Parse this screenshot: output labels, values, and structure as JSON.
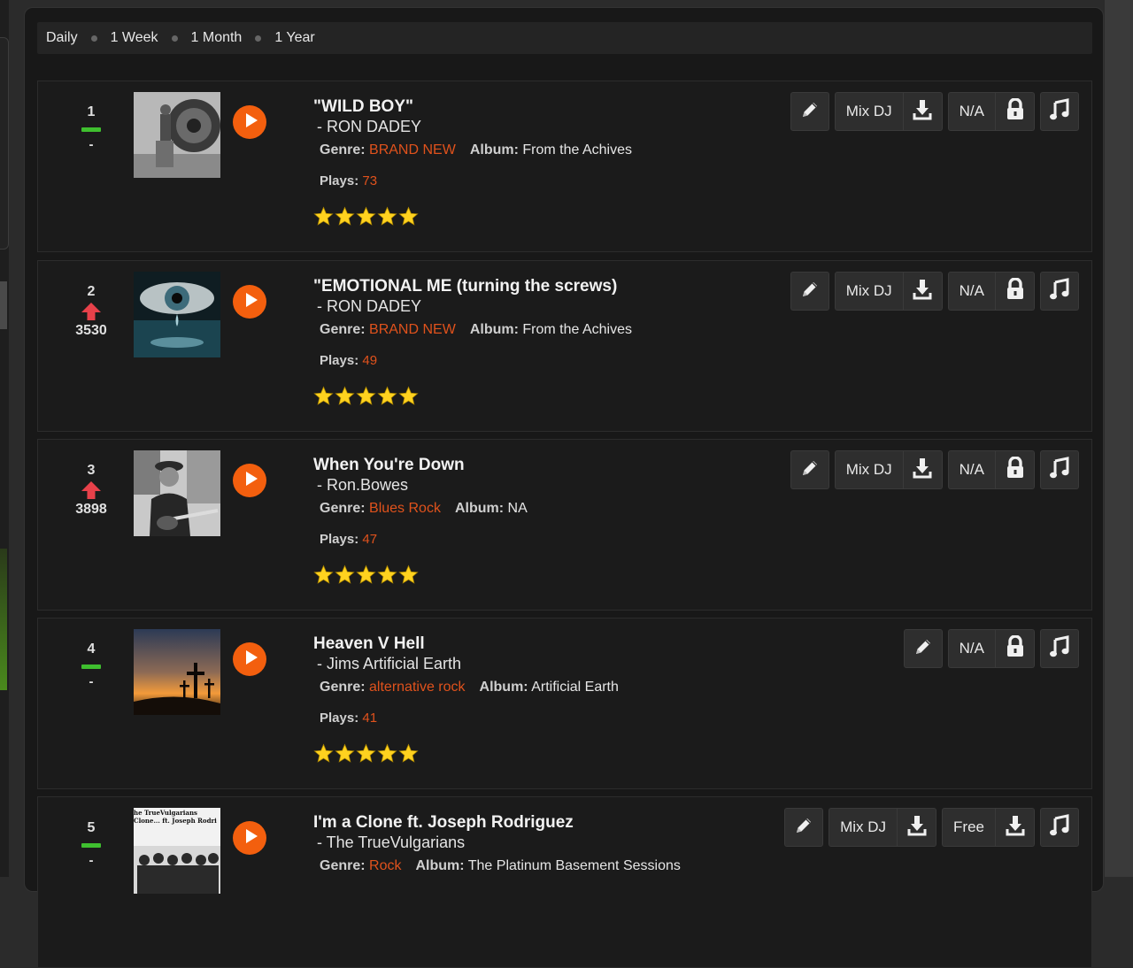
{
  "filters": [
    "Daily",
    "1 Week",
    "1 Month",
    "1 Year"
  ],
  "colors": {
    "accent": "#f35f0e",
    "genre": "#e0521c",
    "rank_up": "#e8414a",
    "rank_same": "#3fbf2f"
  },
  "labels": {
    "genre": "Genre:",
    "album": "Album:",
    "plays": "Plays:"
  },
  "tracks": [
    {
      "rank": "1",
      "trend": "same",
      "change": "-",
      "title": "\"WILD BOY\"",
      "artist": "- RON DADEY",
      "genre": "BRAND NEW",
      "album": "From the Achives",
      "plays": "73",
      "rating": 5,
      "mix_label": "Mix DJ",
      "price_label": "N/A",
      "thumb": "speaker"
    },
    {
      "rank": "2",
      "trend": "up",
      "change": "3530",
      "title": "\"EMOTIONAL ME (turning the screws)",
      "artist": "- RON DADEY",
      "genre": "BRAND NEW",
      "album": "From the Achives",
      "plays": "49",
      "rating": 5,
      "mix_label": "Mix DJ",
      "price_label": "N/A",
      "thumb": "eye"
    },
    {
      "rank": "3",
      "trend": "up",
      "change": "3898",
      "title": "When You're Down",
      "artist": "- Ron.Bowes",
      "genre": "Blues Rock",
      "album": "NA",
      "plays": "47",
      "rating": 5,
      "mix_label": "Mix DJ",
      "price_label": "N/A",
      "thumb": "guitarist"
    },
    {
      "rank": "4",
      "trend": "same",
      "change": "-",
      "title": "Heaven V Hell",
      "artist": "- Jims Artificial Earth",
      "genre": "alternative rock",
      "album": "Artificial Earth",
      "plays": "41",
      "rating": 5,
      "mix_label": "",
      "price_label": "N/A",
      "thumb": "crosses"
    },
    {
      "rank": "5",
      "trend": "same",
      "change": "-",
      "title": "I'm a Clone ft. Joseph Rodriguez",
      "artist": "- The TrueVulgarians",
      "genre": "Rock",
      "album": "The Platinum Basement Sessions",
      "plays": "",
      "rating": 5,
      "mix_label": "Mix DJ",
      "price_label": "Free",
      "thumb": "clone",
      "thumb_text": [
        "he TrueVulgarians",
        "Clone... ft. Joseph Rodri"
      ]
    }
  ]
}
